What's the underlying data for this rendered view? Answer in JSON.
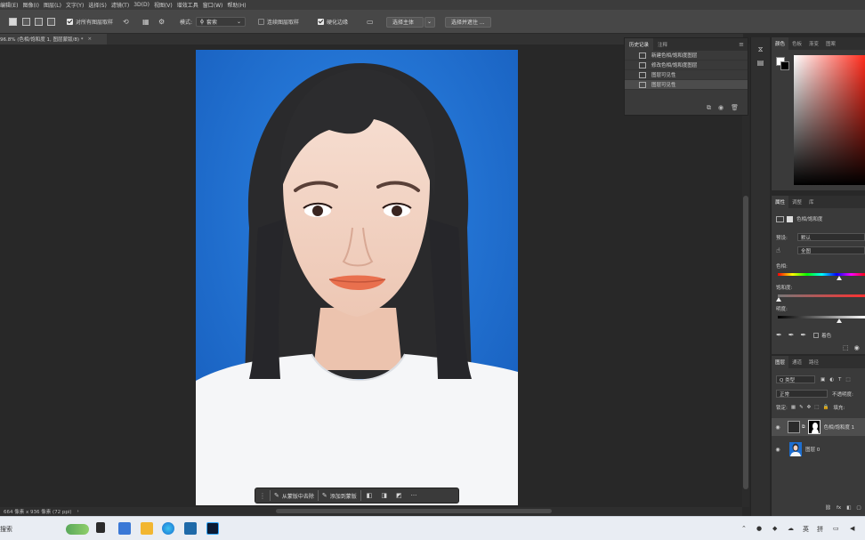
{
  "menu": [
    "编辑(E)",
    "图像(I)",
    "图层(L)",
    "文字(Y)",
    "选择(S)",
    "滤镜(T)",
    "3D(D)",
    "视图(V)",
    "增效工具",
    "窗口(W)",
    "帮助(H)"
  ],
  "options": {
    "sample_all_layers": "对所有图层取样",
    "mode_label": "模式:",
    "mode_value": "套索",
    "auto_enhance": "连续图层取样",
    "enhance_edge": "硬化边缘",
    "select_subject": "选择主体",
    "select_and_mask": "选择并遮住 ..."
  },
  "document": {
    "tab_title": "96.8% (色相/饱和度 1, 图层蒙版/8) *",
    "close": "×"
  },
  "history": {
    "tabs": [
      "历史记录",
      "注释"
    ],
    "items": [
      {
        "label": "新建色相/饱和度图层",
        "selected": false
      },
      {
        "label": "修改色相/饱和度图层",
        "selected": false
      },
      {
        "label": "图层可见性",
        "selected": false
      },
      {
        "label": "图层可见性",
        "selected": true
      }
    ]
  },
  "color_panel": {
    "tabs": [
      "颜色",
      "色板",
      "渐变",
      "图案"
    ],
    "foreground": "#ffffff",
    "background": "#000000"
  },
  "properties": {
    "tabs": [
      "属性",
      "调整",
      "库"
    ],
    "adjustment_name": "色相/饱和度",
    "preset_label": "预设:",
    "preset_value": "默认",
    "channel_value": "全图",
    "hue_label": "色相:",
    "saturation_label": "饱和度:",
    "lightness_label": "明度:",
    "colorize_label": "着色"
  },
  "layers": {
    "tabs": [
      "图层",
      "通道",
      "路径"
    ],
    "filter_value": "Q 类型",
    "blend_mode": "正常",
    "opacity_label": "不透明度:",
    "lock_label": "锁定:",
    "fill_label": "填充:",
    "items": [
      {
        "name": "色相/饱和度 1",
        "selected": true
      },
      {
        "name": "图层 0",
        "selected": false
      }
    ]
  },
  "context_bar": {
    "remove_bg": "从蒙版中去除",
    "add_to_mask": "添加到蒙版",
    "more": "···"
  },
  "status": {
    "text": "664 像素 x 936 像素 (72 ppi)"
  },
  "taskbar": {
    "search": "搜索",
    "lang1": "英",
    "lang2": "拼"
  }
}
